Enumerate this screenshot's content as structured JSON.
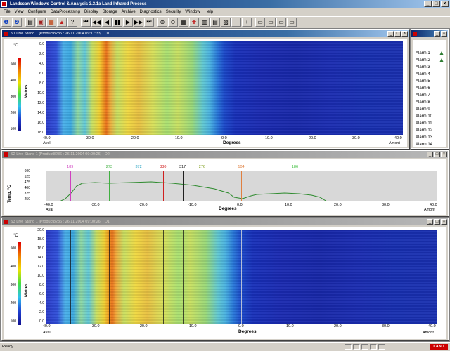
{
  "app": {
    "title": "Landscan Windows Control & Analysis 3.3.1a  Land Infrared Process"
  },
  "menu": [
    "File",
    "View",
    "Configure",
    "DataProcessing",
    "Display",
    "Storage",
    "Archive",
    "Diagnostics",
    "Security",
    "Window",
    "Help"
  ],
  "panel1": {
    "title": "S1 Live Stand 1 [Product8235 : 26.11.2004 09:17:33] : D1",
    "unit": "°C",
    "colorbar_ticks": [
      "500",
      "400",
      "300",
      "200",
      "100"
    ],
    "ylabel": "Metres",
    "yticks": [
      "0.0",
      "2.0",
      "4.0",
      "6.0",
      "8.0",
      "10.0",
      "12.0",
      "14.0",
      "16.0",
      "18.0"
    ],
    "xticks": [
      "-40.0",
      "-30.0",
      "-20.0",
      "-10.0",
      "0.0",
      "10.0",
      "20.0",
      "30.0",
      "40.0"
    ],
    "xlabel": "Degrees",
    "left_end": "Avel",
    "right_end": "Amont"
  },
  "alarm_panel": {
    "alarms": [
      "Alarm 1",
      "Alarm 2",
      "Alarm 3",
      "Alarm 4",
      "Alarm 5",
      "Alarm 6",
      "Alarm 7",
      "Alarm 8",
      "Alarm 9",
      "Alarm 10",
      "Alarm 11",
      "Alarm 12",
      "Alarm 13",
      "Alarm 14"
    ],
    "active": [
      true,
      true,
      false,
      false,
      false,
      false,
      false,
      false,
      false,
      false,
      false,
      false,
      false,
      false
    ]
  },
  "panel2": {
    "title": "S2 Live Stand 1 [Product8236 : 26.11.2004 09:00:26] : D2",
    "ylabel": "Temp. °C",
    "yticks": [
      "600",
      "525",
      "475",
      "400",
      "325",
      "250"
    ],
    "xticks": [
      "-40.0",
      "-30.0",
      "-20.0",
      "-10.0",
      "0.0",
      "10.0",
      "20.0",
      "30.0",
      "40.0"
    ],
    "xlabel": "Degrees",
    "left_end": "Aval",
    "right_end": "Amont",
    "markers": [
      {
        "label": "189",
        "color": "#d040c0",
        "deg": -35
      },
      {
        "label": "273",
        "color": "#40b040",
        "deg": -27
      },
      {
        "label": "372",
        "color": "#20a0c0",
        "deg": -21
      },
      {
        "label": "330",
        "color": "#d02020",
        "deg": -16
      },
      {
        "label": "317",
        "color": "#202020",
        "deg": -12
      },
      {
        "label": "276",
        "color": "#80a020",
        "deg": -8
      },
      {
        "label": "104",
        "color": "#e08040",
        "deg": 0
      },
      {
        "label": "186",
        "color": "#40c040",
        "deg": 11
      }
    ]
  },
  "panel3": {
    "title": "S3 Live Stand 1 [Product8236 : 26.11.2004 09:00:26] : D1",
    "unit": "°C",
    "colorbar_ticks": [
      "500",
      "400",
      "300",
      "200",
      "100"
    ],
    "ylabel": "Metres",
    "yticks": [
      "20.0",
      "18.0",
      "16.0",
      "14.0",
      "12.0",
      "10.0",
      "8.0",
      "6.0",
      "4.0",
      "2.0",
      "0.0"
    ],
    "xticks": [
      "-40.0",
      "-30.0",
      "-20.0",
      "-10.0",
      "0.0",
      "10.0",
      "20.0",
      "30.0",
      "40.0"
    ],
    "xlabel": "Degrees",
    "left_end": "Aval",
    "right_end": "Amont"
  },
  "status": {
    "text": "Ready",
    "logo": "LAND"
  }
}
